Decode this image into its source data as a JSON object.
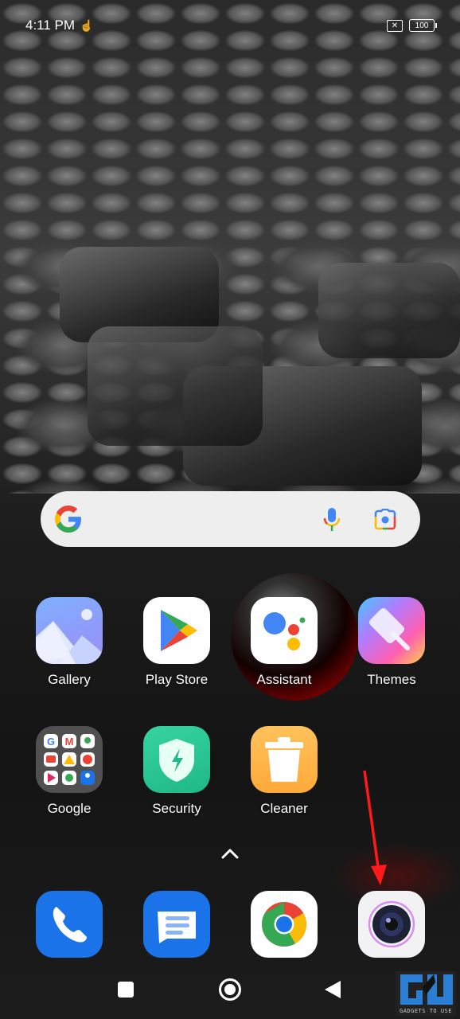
{
  "status_bar": {
    "time": "4:11 PM",
    "battery": "100",
    "sim_status": "no-sim",
    "notification_icon": "touch-hand-icon"
  },
  "search_bar": {
    "google_icon": "google-g-icon",
    "mic_icon": "microphone-icon",
    "lens_icon": "google-lens-icon"
  },
  "apps_row1": [
    {
      "label": "Gallery",
      "icon": "gallery-icon"
    },
    {
      "label": "Play Store",
      "icon": "play-store-icon"
    },
    {
      "label": "Assistant",
      "icon": "assistant-icon"
    },
    {
      "label": "Themes",
      "icon": "themes-icon"
    }
  ],
  "apps_row2": [
    {
      "label": "Google",
      "icon": "google-folder-icon"
    },
    {
      "label": "Security",
      "icon": "security-icon"
    },
    {
      "label": "Cleaner",
      "icon": "cleaner-icon"
    }
  ],
  "dock": [
    {
      "name": "Phone",
      "icon": "phone-icon"
    },
    {
      "name": "Messages",
      "icon": "messages-icon"
    },
    {
      "name": "Chrome",
      "icon": "chrome-icon"
    },
    {
      "name": "Camera",
      "icon": "camera-icon"
    }
  ],
  "navigation": {
    "recents": "recents-button",
    "home": "home-button",
    "back": "back-button"
  },
  "annotation": {
    "arrow_color": "#ff1a1a",
    "target": "Camera"
  },
  "watermark": {
    "text": "GADGETS TO USE",
    "color": "#2a7fd4"
  }
}
